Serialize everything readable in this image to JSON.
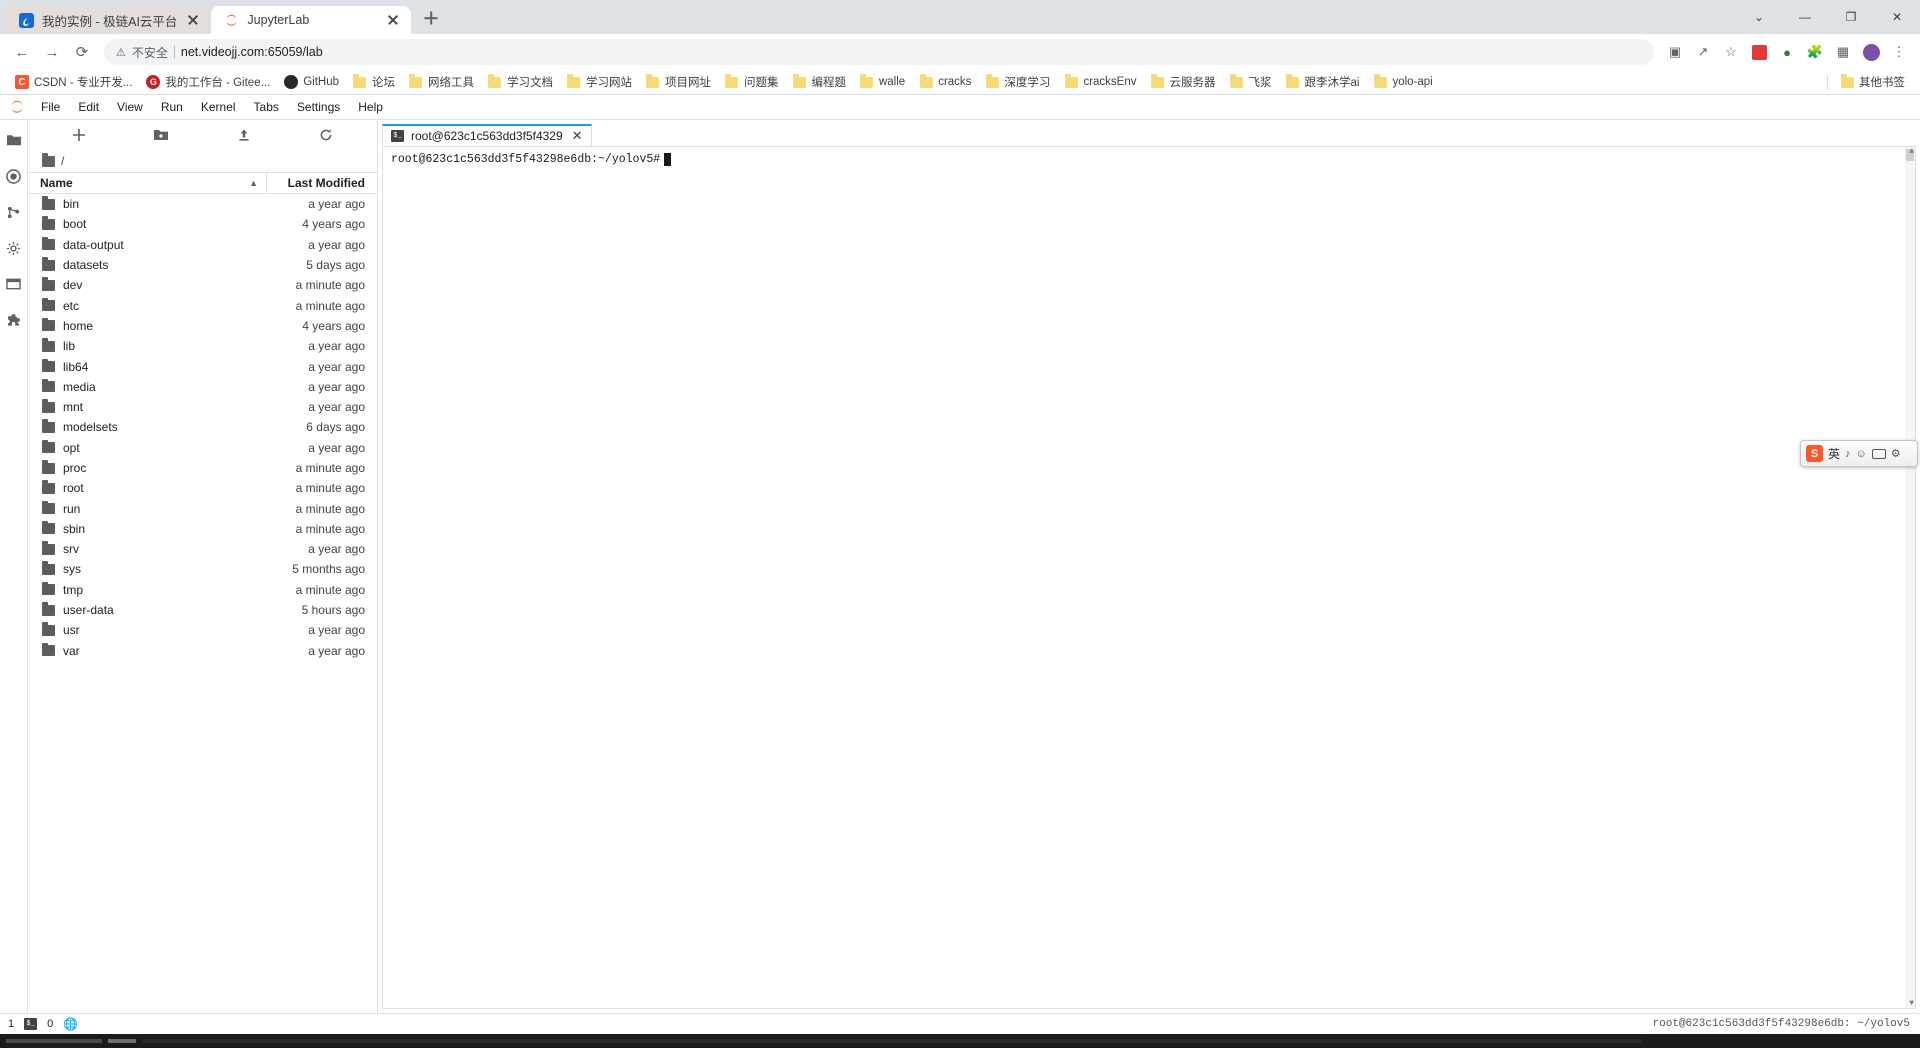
{
  "browser": {
    "tabs": [
      {
        "title": "我的实例 - 极链AI云平台",
        "favicon": "cloud-platform-icon",
        "active": false
      },
      {
        "title": "JupyterLab",
        "favicon": "jupyter-icon",
        "active": true
      }
    ],
    "new_tab_label": "+",
    "window_controls": {
      "minimize": "—",
      "maximize": "❐",
      "close": "✕",
      "more": "⌄"
    },
    "nav": {
      "back": "←",
      "forward": "→",
      "reload": "⟳"
    },
    "omnibox": {
      "security_icon": "warning-triangle-icon",
      "security_label": "不安全",
      "url": "net.videojj.com:65059/lab"
    },
    "toolbar_icons": [
      "translate-icon",
      "share-icon",
      "bookmark-star-icon",
      "extension-red-icon",
      "extension-green-icon",
      "puzzle-icon",
      "sidepanel-icon",
      "profile-avatar",
      "more-menu-icon"
    ]
  },
  "bookmarks": {
    "items": [
      {
        "label": "CSDN - 专业开发...",
        "icon": "csdn-icon"
      },
      {
        "label": "我的工作台 - Gitee...",
        "icon": "gitee-icon"
      },
      {
        "label": "GitHub",
        "icon": "github-icon"
      },
      {
        "label": "论坛",
        "icon": "folder-icon"
      },
      {
        "label": "网络工具",
        "icon": "folder-icon"
      },
      {
        "label": "学习文档",
        "icon": "folder-icon"
      },
      {
        "label": "学习网站",
        "icon": "folder-icon"
      },
      {
        "label": "项目网址",
        "icon": "folder-icon"
      },
      {
        "label": "问题集",
        "icon": "folder-icon"
      },
      {
        "label": "编程题",
        "icon": "folder-icon"
      },
      {
        "label": "walle",
        "icon": "folder-icon"
      },
      {
        "label": "cracks",
        "icon": "folder-icon"
      },
      {
        "label": "深度学习",
        "icon": "folder-icon"
      },
      {
        "label": "cracksEnv",
        "icon": "folder-icon"
      },
      {
        "label": "云服务器",
        "icon": "folder-icon"
      },
      {
        "label": "飞浆",
        "icon": "folder-icon"
      },
      {
        "label": "跟李沐学ai",
        "icon": "folder-icon"
      },
      {
        "label": "yolo-api",
        "icon": "folder-icon"
      }
    ],
    "other": {
      "label": "其他书签",
      "icon": "folder-icon"
    }
  },
  "jupyter": {
    "menu": [
      "File",
      "Edit",
      "View",
      "Run",
      "Kernel",
      "Tabs",
      "Settings",
      "Help"
    ],
    "rail_icons": [
      "file-browser-icon",
      "running-terminals-icon",
      "git-icon",
      "property-inspector-icon",
      "open-tabs-icon",
      "extension-manager-icon"
    ],
    "file_browser": {
      "toolbar": [
        "new-launcher-icon",
        "new-folder-icon",
        "upload-icon",
        "refresh-icon"
      ],
      "breadcrumb": "/",
      "columns": {
        "name": "Name",
        "last_modified": "Last Modified",
        "sort_arrow": "▲"
      },
      "rows": [
        {
          "name": "bin",
          "modified": "a year ago"
        },
        {
          "name": "boot",
          "modified": "4 years ago"
        },
        {
          "name": "data-output",
          "modified": "a year ago"
        },
        {
          "name": "datasets",
          "modified": "5 days ago"
        },
        {
          "name": "dev",
          "modified": "a minute ago"
        },
        {
          "name": "etc",
          "modified": "a minute ago"
        },
        {
          "name": "home",
          "modified": "4 years ago"
        },
        {
          "name": "lib",
          "modified": "a year ago"
        },
        {
          "name": "lib64",
          "modified": "a year ago"
        },
        {
          "name": "media",
          "modified": "a year ago"
        },
        {
          "name": "mnt",
          "modified": "a year ago"
        },
        {
          "name": "modelsets",
          "modified": "6 days ago"
        },
        {
          "name": "opt",
          "modified": "a year ago"
        },
        {
          "name": "proc",
          "modified": "a minute ago"
        },
        {
          "name": "root",
          "modified": "a minute ago"
        },
        {
          "name": "run",
          "modified": "a minute ago"
        },
        {
          "name": "sbin",
          "modified": "a minute ago"
        },
        {
          "name": "srv",
          "modified": "a year ago"
        },
        {
          "name": "sys",
          "modified": "5 months ago"
        },
        {
          "name": "tmp",
          "modified": "a minute ago"
        },
        {
          "name": "user-data",
          "modified": "5 hours ago"
        },
        {
          "name": "usr",
          "modified": "a year ago"
        },
        {
          "name": "var",
          "modified": "a year ago"
        }
      ]
    },
    "dock": {
      "tab_label": "root@623c1c563dd3f5f4329",
      "tab_icon": "terminal-icon",
      "close_label": "✕"
    },
    "terminal": {
      "prompt": "root@623c1c563dd3f5f43298e6db:~/yolov5#",
      "cursor": ""
    },
    "status": {
      "count_left": "1",
      "terminal_icon": "terminal-icon",
      "count_right": "0",
      "globe_icon": "globe-icon",
      "right_text": "root@623c1c563dd3f5f43298e6db: ~/yolov5"
    }
  },
  "ime": {
    "logo": "S",
    "mode": "英",
    "icons": [
      "voice-icon",
      "emoji-icon",
      "keyboard-icon",
      "toolbox-icon"
    ]
  }
}
